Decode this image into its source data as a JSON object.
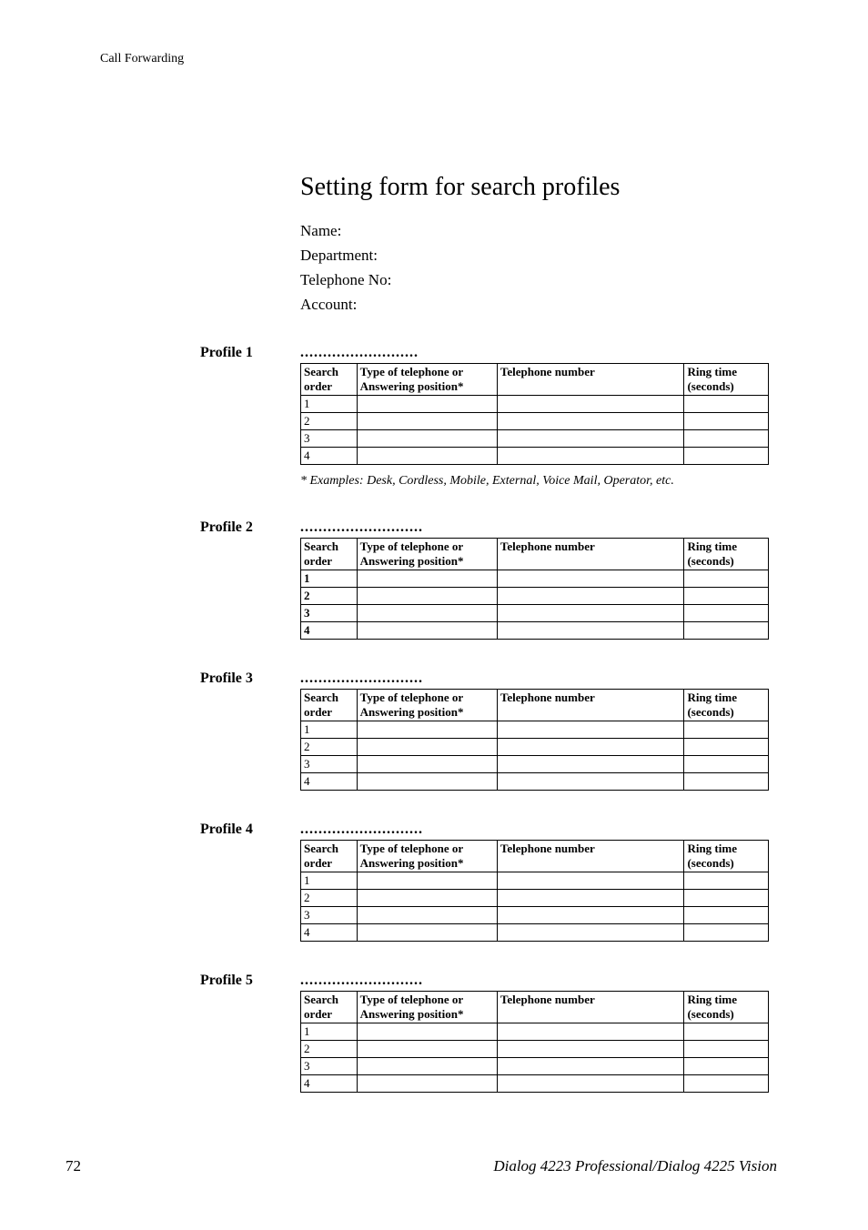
{
  "header": "Call Forwarding",
  "main_title": "Setting form for search profiles",
  "fields": {
    "name": "Name:",
    "department": "Department:",
    "telephone_no": "Telephone No:",
    "account": "Account:"
  },
  "table_headers": {
    "search_order": "Search order",
    "type": "Type of telephone or Answering position*",
    "telephone_number": "Telephone number",
    "ring_time": "Ring time (seconds)"
  },
  "profiles": [
    {
      "label": "Profile 1",
      "dots": "..........................",
      "bold_rows": false,
      "rows": [
        "1",
        "2",
        "3",
        "4"
      ]
    },
    {
      "label": "Profile 2",
      "dots": "...........................",
      "bold_rows": true,
      "rows": [
        "1",
        "2",
        "3",
        "4"
      ]
    },
    {
      "label": "Profile 3",
      "dots": "...........................",
      "bold_rows": false,
      "rows": [
        "1",
        "2",
        "3",
        "4"
      ]
    },
    {
      "label": "Profile 4",
      "dots": "...........................",
      "bold_rows": false,
      "rows": [
        "1",
        "2",
        "3",
        "4"
      ]
    },
    {
      "label": "Profile 5",
      "dots": "...........................",
      "bold_rows": false,
      "rows": [
        "1",
        "2",
        "3",
        "4"
      ]
    }
  ],
  "note": "* Examples: Desk, Cordless, Mobile, External, Voice Mail, Operator, etc.",
  "footer": {
    "page": "72",
    "text": "Dialog 4223 Professional/Dialog 4225 Vision"
  }
}
